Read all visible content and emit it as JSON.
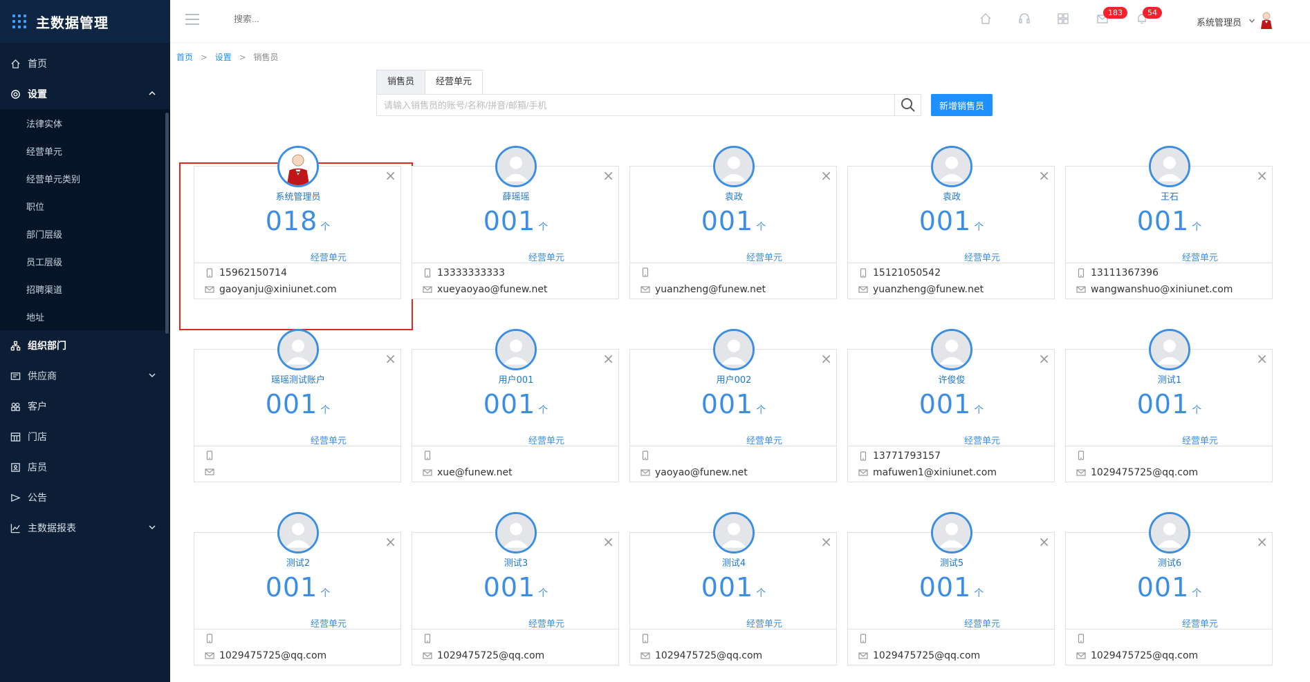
{
  "app": {
    "title": "主数据管理"
  },
  "sidebar": {
    "items": [
      {
        "label": "首页",
        "icon": "home-icon"
      },
      {
        "label": "设置",
        "icon": "gear-icon",
        "expanded": true,
        "children": [
          "法律实体",
          "经营单元",
          "经营单元类别",
          "职位",
          "部门层级",
          "员工层级",
          "招聘渠道",
          "地址"
        ]
      },
      {
        "label": "组织部门",
        "icon": "org-icon"
      },
      {
        "label": "供应商",
        "icon": "supplier-icon",
        "has_children": true
      },
      {
        "label": "客户",
        "icon": "customer-icon"
      },
      {
        "label": "门店",
        "icon": "store-icon"
      },
      {
        "label": "店员",
        "icon": "clerk-icon"
      },
      {
        "label": "公告",
        "icon": "announce-icon"
      },
      {
        "label": "主数据报表",
        "icon": "chart-icon",
        "has_children": true
      }
    ]
  },
  "topbar": {
    "search_placeholder": "搜索...",
    "badges": {
      "messages": "183",
      "notifications": "54"
    },
    "user_name": "系统管理员"
  },
  "breadcrumb": {
    "home": "首页",
    "settings": "设置",
    "current": "销售员",
    "sep": ">"
  },
  "tabs": [
    "销售员",
    "经营单元"
  ],
  "search": {
    "placeholder": "请输入销售员的账号/名称/拼音/邮箱/手机",
    "value": ""
  },
  "add_button": "新增销售员",
  "count_unit": "个",
  "count_label": "经营单元",
  "cards": [
    {
      "name": "系统管理员",
      "count": "018",
      "phone": "15962150714",
      "email": "gaoyanju@xiniunet.com",
      "avatar": "admin"
    },
    {
      "name": "薛瑶瑶",
      "count": "001",
      "phone": "13333333333",
      "email": "xueyaoyao@funew.net"
    },
    {
      "name": "袁政",
      "count": "001",
      "phone": "",
      "email": "yuanzheng@funew.net"
    },
    {
      "name": "袁政",
      "count": "001",
      "phone": "15121050542",
      "email": "yuanzheng@funew.net"
    },
    {
      "name": "王石",
      "count": "001",
      "phone": "13111367396",
      "email": "wangwanshuo@xiniunet.com"
    },
    {
      "name": "瑶瑶测试账户",
      "count": "001",
      "phone": "",
      "email": ""
    },
    {
      "name": "用户001",
      "count": "001",
      "phone": "",
      "email": "xue@funew.net"
    },
    {
      "name": "用户002",
      "count": "001",
      "phone": "",
      "email": "yaoyao@funew.net"
    },
    {
      "name": "许俊俊",
      "count": "001",
      "phone": "13771793157",
      "email": "mafuwen1@xiniunet.com"
    },
    {
      "name": "测试1",
      "count": "001",
      "phone": "",
      "email": "1029475725@qq.com"
    },
    {
      "name": "测试2",
      "count": "001",
      "phone": "",
      "email": "1029475725@qq.com"
    },
    {
      "name": "测试3",
      "count": "001",
      "phone": "",
      "email": "1029475725@qq.com"
    },
    {
      "name": "测试4",
      "count": "001",
      "phone": "",
      "email": "1029475725@qq.com"
    },
    {
      "name": "测试5",
      "count": "001",
      "phone": "",
      "email": "1029475725@qq.com"
    },
    {
      "name": "测试6",
      "count": "001",
      "phone": "",
      "email": "1029475725@qq.com"
    }
  ],
  "colors": {
    "sidebar": "#0b1e36",
    "accent": "#3c8ee2",
    "button": "#1e90ff",
    "highlight": "#e1251b",
    "badge": "#f5222d"
  }
}
